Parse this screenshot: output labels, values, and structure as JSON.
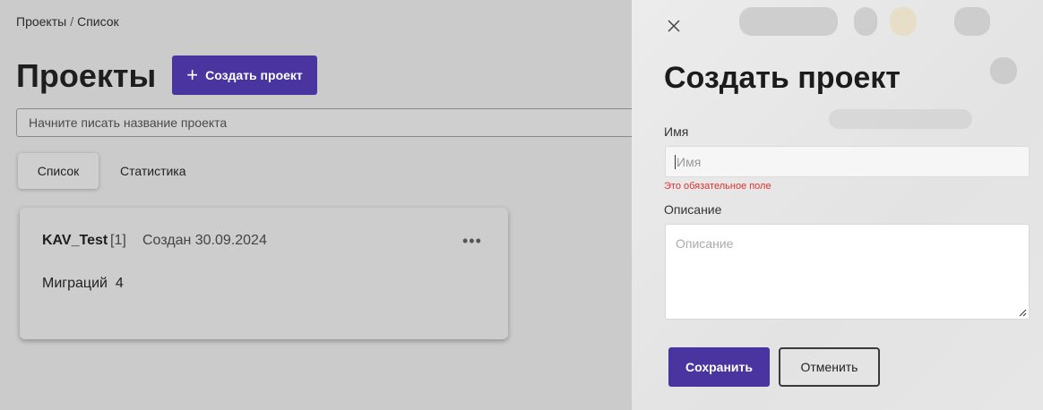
{
  "breadcrumb": {
    "items": [
      "Проекты",
      "Список"
    ],
    "separator": "/"
  },
  "page": {
    "title": "Проекты",
    "create_button": "Создать проект",
    "search_placeholder": "Начните писать название проекта",
    "tabs": [
      {
        "label": "Список",
        "active": true
      },
      {
        "label": "Статистика",
        "active": false
      }
    ]
  },
  "project_card": {
    "name": "KAV_Test",
    "count": "[1]",
    "created": "Создан 30.09.2024",
    "more_icon": "more-horizontal-icon",
    "migrations_label": "Миграций",
    "migrations_value": "4"
  },
  "drawer": {
    "close_icon": "close-icon",
    "title": "Создать проект",
    "name_label": "Имя",
    "name_placeholder": "Имя",
    "name_value": "",
    "error_text": "Это обязательное поле",
    "description_label": "Описание",
    "description_placeholder": "Описание",
    "save_button": "Сохранить",
    "cancel_button": "Отменить"
  },
  "colors": {
    "accent": "#4a35a0",
    "error": "#e03030",
    "overlay": "#cbcbcb"
  }
}
